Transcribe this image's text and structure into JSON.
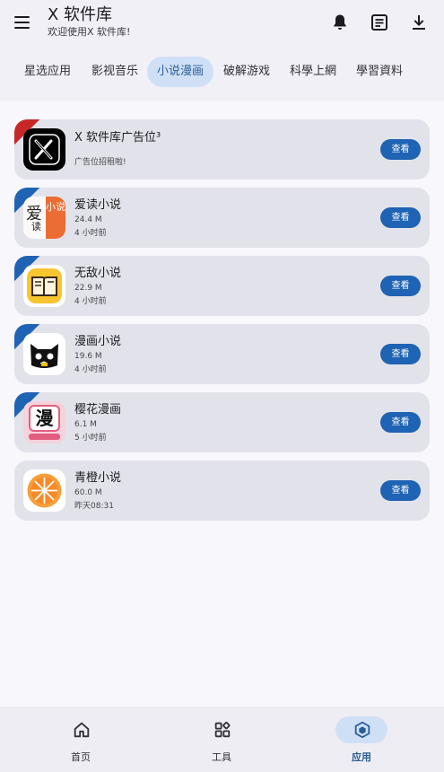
{
  "header": {
    "title": "X 软件库",
    "subtitle": "欢迎使用X 软件库!",
    "icons": [
      "menu-icon",
      "bell-icon",
      "notes-icon",
      "download-icon"
    ]
  },
  "tabs": [
    {
      "label": "星选应用",
      "active": false
    },
    {
      "label": "影视音乐",
      "active": false
    },
    {
      "label": "小说漫画",
      "active": true
    },
    {
      "label": "破解游戏",
      "active": false
    },
    {
      "label": "科學上網",
      "active": false
    },
    {
      "label": "學習資料",
      "active": false
    }
  ],
  "cards": [
    {
      "name": "X 软件库广告位³",
      "desc": "广告位招租啦!",
      "button": "查看",
      "ribbon_color": "#c62828",
      "icon": "x-logo-icon"
    },
    {
      "name": "爱读小说",
      "size": "24.4 M",
      "time": "4 小时前",
      "button": "查看",
      "ribbon_color": "#1f63b4",
      "icon": "aidu-novel-icon",
      "icon_text_left": "爱",
      "icon_text_left2": "读",
      "icon_text_right": "小说"
    },
    {
      "name": "无敌小说",
      "size": "22.9 M",
      "time": "4 小时前",
      "button": "查看",
      "ribbon_color": "#1f63b4",
      "icon": "book-icon"
    },
    {
      "name": "漫画小说",
      "size": "19.6 M",
      "time": "4 小时前",
      "button": "查看",
      "ribbon_color": "#1f63b4",
      "icon": "cat-icon"
    },
    {
      "name": "樱花漫画",
      "size": "6.1 M",
      "time": "5 小时前",
      "button": "查看",
      "ribbon_color": "#1f63b4",
      "icon": "manhua-icon",
      "icon_text": "漫"
    },
    {
      "name": "青橙小说",
      "size": "60.0 M",
      "time": "昨天08:31",
      "button": "查看",
      "ribbon_color": null,
      "icon": "orange-icon"
    }
  ],
  "bottom_nav": [
    {
      "label": "首页",
      "icon": "home-icon",
      "active": false
    },
    {
      "label": "工具",
      "icon": "grid-icon",
      "active": false
    },
    {
      "label": "应用",
      "icon": "cube-icon",
      "active": true
    }
  ]
}
